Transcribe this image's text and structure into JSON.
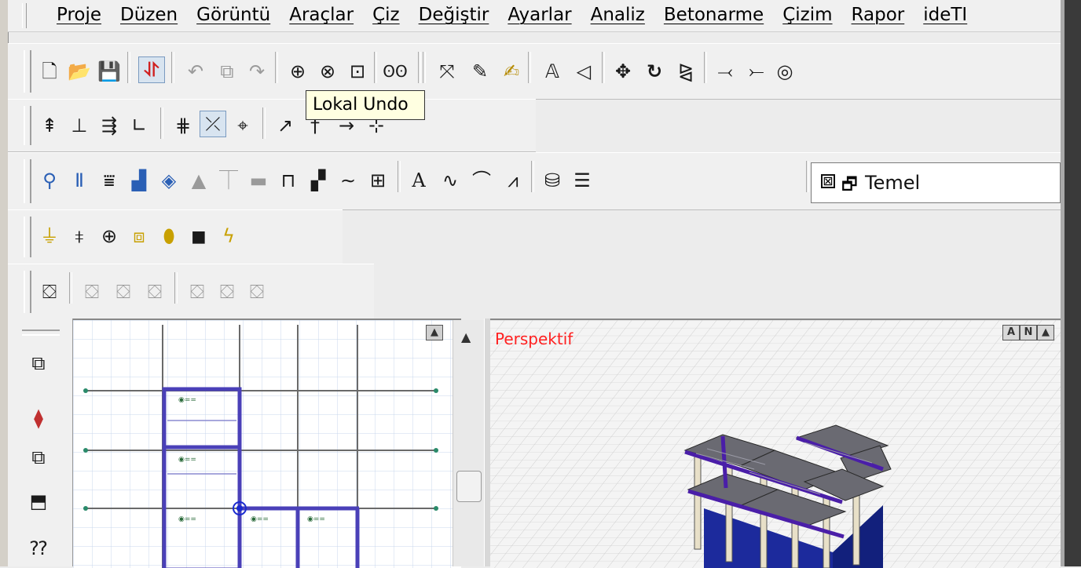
{
  "menu": {
    "items": [
      "Proje",
      "Düzen",
      "Görüntü",
      "Araçlar",
      "Çiz",
      "Değiştir",
      "Ayarlar",
      "Analiz",
      "Betonarme",
      "Çizim",
      "Rapor",
      "ideTI"
    ]
  },
  "tooltip": {
    "text": "Lokal Undo"
  },
  "layer_combo": {
    "value": "Temel",
    "checked_glyph": "⊠",
    "lock_glyph": "🗗"
  },
  "toolbar1": {
    "icons": [
      "new-file-icon",
      "open-folder-icon",
      "save-icon",
      "undo-marker-icon",
      "undo-icon",
      "redo-box-icon",
      "redo-icon",
      "zoom-in-icon",
      "zoom-pan-icon",
      "zoom-window-icon",
      "glasses-icon",
      "pick-icon",
      "pen-icon",
      "edit-text-icon",
      "text-style-icon",
      "rotate-view-icon",
      "move-icon",
      "rotate-icon",
      "mirror-icon",
      "trim-icon",
      "extend-icon"
    ]
  },
  "plan_view": {
    "corner_label": "▲"
  },
  "perspective_view": {
    "label": "Perspektif",
    "corner_buttons": [
      "A",
      "N",
      "▲"
    ]
  },
  "colors": {
    "accent_label": "#ff2020",
    "tooltip_bg": "#ffffe1",
    "beam": "#3b2f9a",
    "base": "#1c2a9c"
  }
}
